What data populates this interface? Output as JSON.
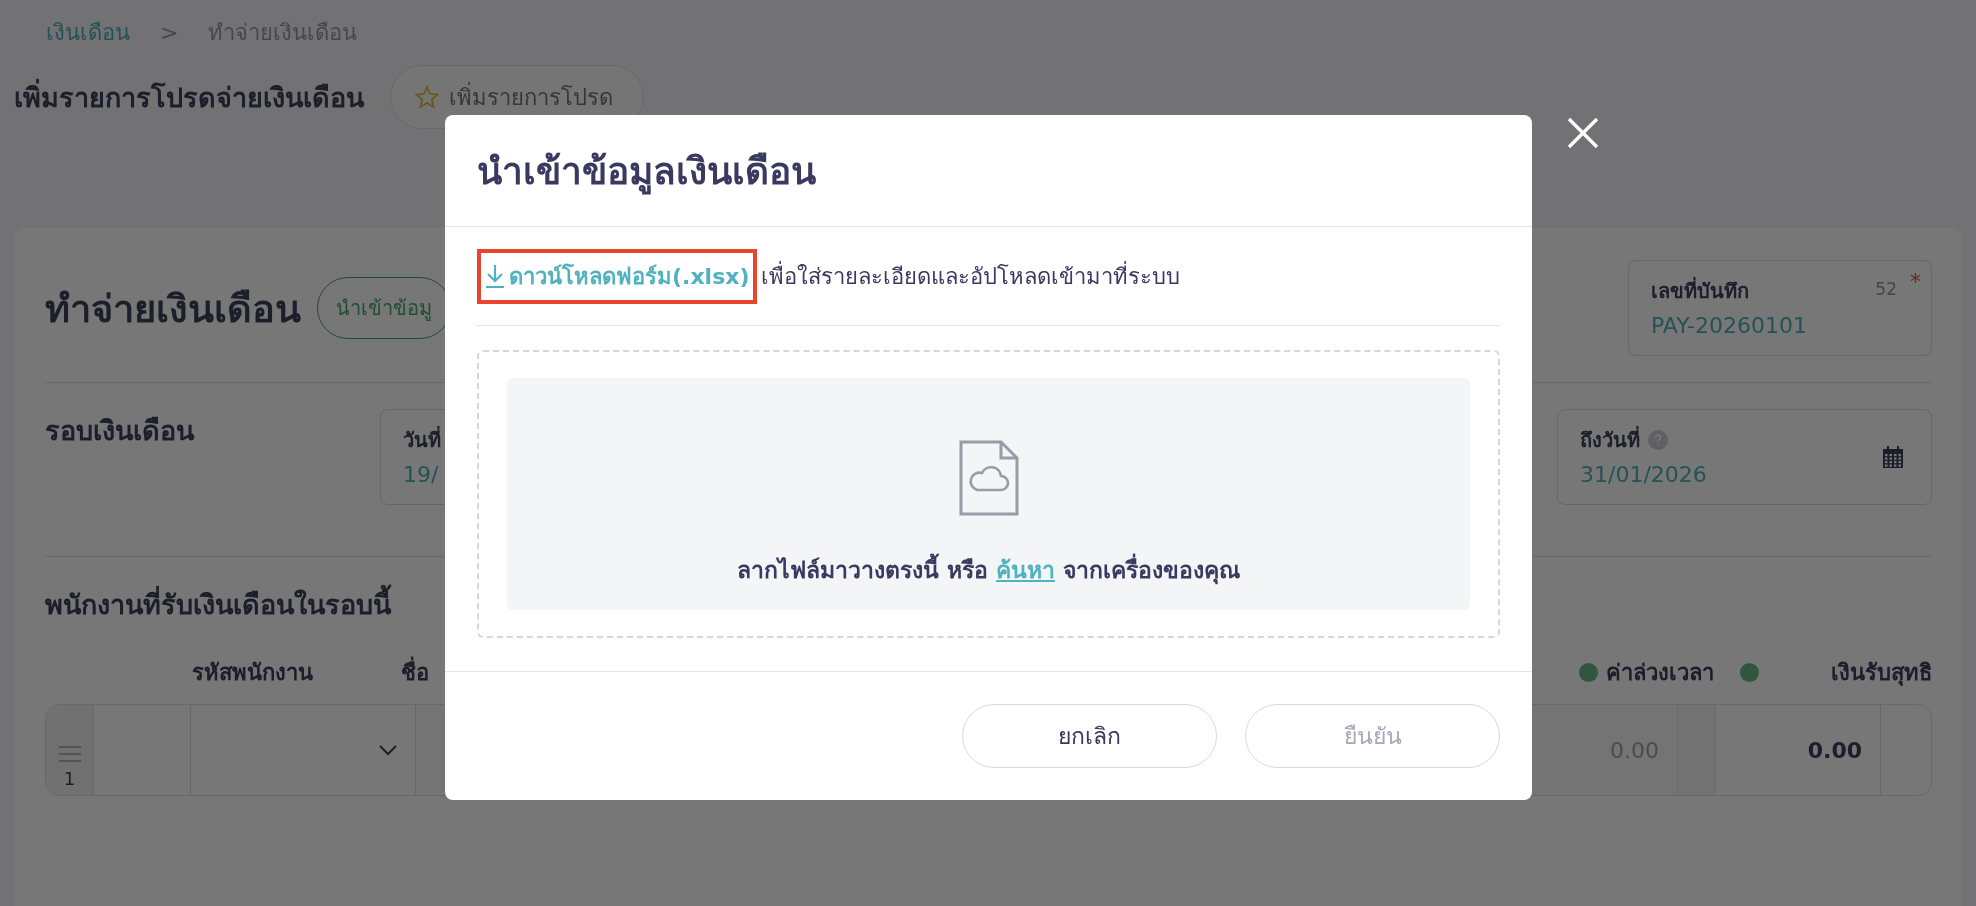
{
  "breadcrumb": [
    {
      "label": "เงินเดือน",
      "kind": "link"
    },
    {
      "label": ">",
      "kind": "separator"
    },
    {
      "label": "ทำจ่ายเงินเดือน",
      "kind": "current"
    }
  ],
  "page_header": {
    "title": "เพิ่มรายการโปรดจ่ายเงินเดือน",
    "favorite_button": "เพิ่มรายการโปรด"
  },
  "card": {
    "title": "ทำจ่ายเงินเดือน",
    "import_button": "นำเข้าข้อมู",
    "record_field": {
      "label": "เลขที่บันทึก",
      "counter": "52",
      "required": true,
      "required_mark": "*",
      "value": "PAY-20260101"
    },
    "period": {
      "title": "รอบเงินเดือน",
      "start_field": {
        "label": "วันที่",
        "value": "19/"
      },
      "end_field": {
        "label": "ถึงวันที่",
        "value": "31/01/2026"
      }
    },
    "employees": {
      "title": "พนักงานที่รับเงินเดือนในรอบนี้",
      "columns_left": [
        "รหัสพนักงาน",
        "ชื่อ"
      ],
      "columns_right": [
        {
          "label": "ค่าล่วงเวลา",
          "dot": true
        },
        {
          "dot": true
        },
        {
          "label": "เงินรับสุทธิ",
          "dot": false
        }
      ],
      "rows": [
        {
          "number": "1",
          "overtime": "0.00",
          "net": "0.00"
        }
      ]
    }
  },
  "modal": {
    "title": "นำเข้าข้อมูลเงินเดือน",
    "download_link": {
      "label": "ดาวน์โหลดฟอร์ม(.xlsx)",
      "highlighted": true
    },
    "download_hint": "เพื่อใส่รายละเอียดและอัปโหลดเข้ามาที่ระบบ",
    "dropzone": {
      "text_before": "ลากไฟล์มาวางตรงนี้ หรือ",
      "browse_link": "ค้นหา",
      "text_after": "จากเครื่องของคุณ"
    },
    "buttons": [
      {
        "label": "ยกเลิก",
        "disabled": false
      },
      {
        "label": "ยืนยัน",
        "disabled": true
      }
    ]
  }
}
